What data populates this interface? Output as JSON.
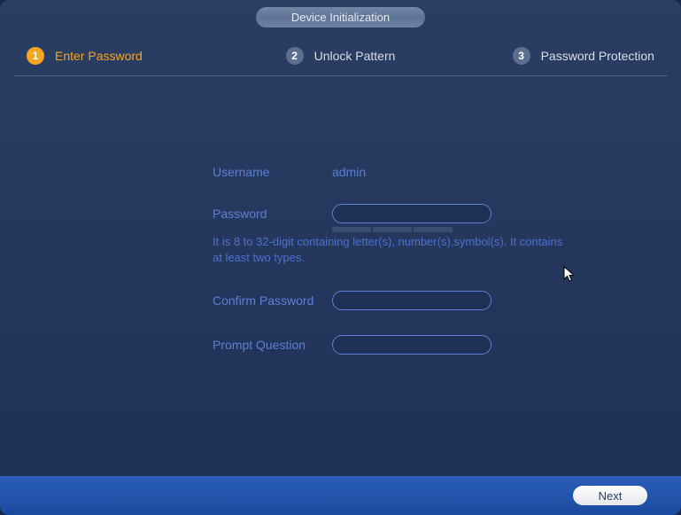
{
  "title": "Device Initialization",
  "steps": [
    {
      "num": "1",
      "label": "Enter Password",
      "active": true
    },
    {
      "num": "2",
      "label": "Unlock Pattern",
      "active": false
    },
    {
      "num": "3",
      "label": "Password Protection",
      "active": false
    }
  ],
  "form": {
    "username_label": "Username",
    "username_value": "admin",
    "password_label": "Password",
    "password_value": "",
    "hint": "It is 8 to 32-digit containing letter(s), number(s),symbol(s). It contains at least two types.",
    "confirm_label": "Confirm Password",
    "confirm_value": "",
    "prompt_label": "Prompt Question",
    "prompt_value": ""
  },
  "footer": {
    "next_label": "Next"
  }
}
